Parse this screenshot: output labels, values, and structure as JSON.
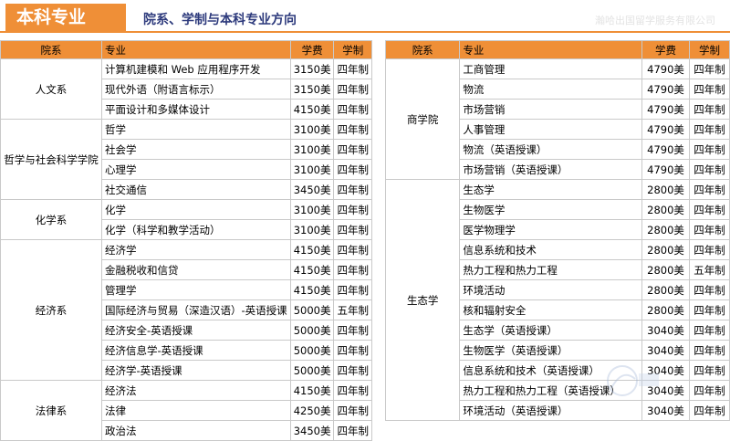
{
  "header": {
    "tag": "本科专业",
    "title": "院系、学制与本科专业方向",
    "org": "瀚哈出国留学服务有限公司"
  },
  "columns": [
    "院系",
    "专业",
    "学费",
    "学制"
  ],
  "left_groups": [
    {
      "dept": "人文系",
      "rows": [
        [
          "计算机建模和 Web 应用程序开发",
          "3150美",
          "四年制"
        ],
        [
          "现代外语（附语言标示）",
          "3150美",
          "四年制"
        ],
        [
          "平面设计和多媒体设计",
          "4150美",
          "四年制"
        ]
      ]
    },
    {
      "dept": "哲学与社会科学学院",
      "rows": [
        [
          "哲学",
          "3100美",
          "四年制"
        ],
        [
          "社会学",
          "3100美",
          "四年制"
        ],
        [
          "心理学",
          "3100美",
          "四年制"
        ],
        [
          "社交通信",
          "3450美",
          "四年制"
        ]
      ]
    },
    {
      "dept": "化学系",
      "rows": [
        [
          "化学",
          "3100美",
          "四年制"
        ],
        [
          "化学（科学和教学活动）",
          "3100美",
          "四年制"
        ]
      ]
    },
    {
      "dept": "经济系",
      "rows": [
        [
          "经济学",
          "4150美",
          "四年制"
        ],
        [
          "金融税收和信贷",
          "4150美",
          "四年制"
        ],
        [
          "管理学",
          "4150美",
          "四年制"
        ],
        [
          "国际经济与贸易（深造汉语）-英语授课",
          "5000美",
          "五年制"
        ],
        [
          "经济安全-英语授课",
          "5000美",
          "四年制"
        ],
        [
          "经济信息学-英语授课",
          "5000美",
          "四年制"
        ],
        [
          "经济学-英语授课",
          "5000美",
          "四年制"
        ]
      ]
    },
    {
      "dept": "法律系",
      "rows": [
        [
          "经济法",
          "4150美",
          "四年制"
        ],
        [
          "法律",
          "4250美",
          "四年制"
        ],
        [
          "政治法",
          "3450美",
          "四年制"
        ]
      ]
    }
  ],
  "right_groups": [
    {
      "dept": "商学院",
      "rows": [
        [
          "工商管理",
          "4790美",
          "四年制"
        ],
        [
          "物流",
          "4790美",
          "四年制"
        ],
        [
          "市场营销",
          "4790美",
          "四年制"
        ],
        [
          "人事管理",
          "4790美",
          "四年制"
        ],
        [
          "物流（英语授课）",
          "4790美",
          "四年制"
        ],
        [
          "市场营销（英语授课）",
          "4790美",
          "四年制"
        ]
      ]
    },
    {
      "dept": "生态学",
      "rows": [
        [
          "生态学",
          "2800美",
          "四年制"
        ],
        [
          "生物医学",
          "2800美",
          "四年制"
        ],
        [
          "医学物理学",
          "2800美",
          "四年制"
        ],
        [
          "信息系统和技术",
          "2800美",
          "四年制"
        ],
        [
          "热力工程和热力工程",
          "2800美",
          "五年制"
        ],
        [
          "环境活动",
          "2800美",
          "四年制"
        ],
        [
          "核和辐射安全",
          "2800美",
          "四年制"
        ],
        [
          "生态学（英语授课）",
          "3040美",
          "四年制"
        ],
        [
          "生物医学（英语授课）",
          "3040美",
          "四年制"
        ],
        [
          "信息系统和技术（英语授课）",
          "3040美",
          "四年制"
        ],
        [
          "热力工程和热力工程（英语授课）",
          "3040美",
          "四年制"
        ],
        [
          "环境活动（英语授课）",
          "3040美",
          "四年制"
        ]
      ]
    }
  ],
  "colors": {
    "accent": "#ef8f37",
    "title": "#2d3a7c"
  }
}
